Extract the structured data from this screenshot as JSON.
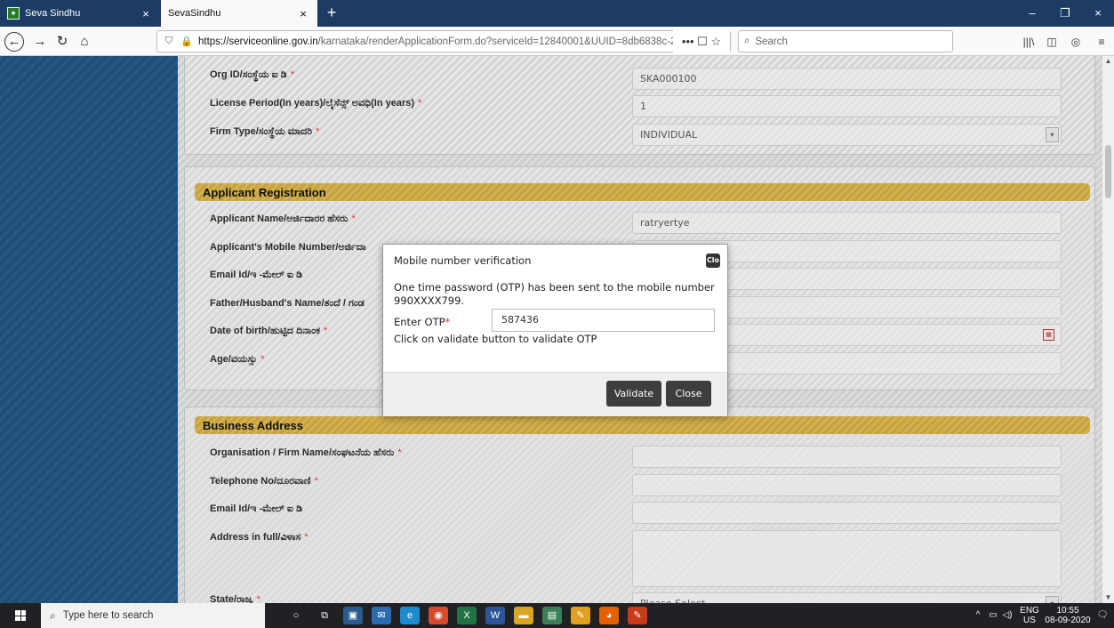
{
  "browser": {
    "tabs": [
      {
        "label": "Seva Sindhu",
        "close": "×"
      },
      {
        "label": "SevaSindhu",
        "close": "×"
      }
    ],
    "new_tab": "+",
    "window_controls": {
      "minimize": "–",
      "maximize": "❐",
      "close": "×"
    },
    "nav": {
      "back": "←",
      "forward": "→",
      "reload": "↻",
      "home": "⌂"
    },
    "url": {
      "host": "https://serviceonline.gov.in",
      "rest": "/karnataka/renderApplicationForm.do?serviceId=12840001&UUID=8db6838c-26(",
      "actions": "••• ☐ ☆"
    },
    "search_placeholder": "Search",
    "icons": [
      "library-icon",
      "sidebar-icon",
      "account-icon",
      "menu-icon"
    ]
  },
  "form": {
    "top_fields": [
      {
        "label": "Org ID/ಸಂಸ್ಥೆಯ ಐ ಡಿ",
        "required": "*",
        "value": "SKA000100",
        "kind": "text"
      },
      {
        "label": "License Period(In years)/ಲೈಸೆನ್ಸ್ ಅವಧಿ(In years)",
        "required": "*",
        "value": "1",
        "kind": "text"
      },
      {
        "label": "Firm Type/ಸಂಸ್ಥೆಯ ಮಾದರಿ",
        "required": "*",
        "value": "INDIVIDUAL",
        "kind": "select"
      }
    ],
    "applicant": {
      "heading": "Applicant Registration",
      "fields": [
        {
          "label": "Applicant Name/ಅರ್ಜಿದಾರರ ಹೆಸರು",
          "required": "*",
          "value": "ratryertye",
          "kind": "text"
        },
        {
          "label": "Applicant's Mobile Number/ಅರ್ಜಿದಾ",
          "required": "",
          "value": "",
          "kind": "text"
        },
        {
          "label": "Email Id/ಇ -ಮೇಲ್ ಐ ಡಿ",
          "required": "",
          "value": "om",
          "kind": "text"
        },
        {
          "label": "Father/Husband's Name/ತಂದೆ / ಗಂಡ",
          "required": "",
          "value": "",
          "kind": "text"
        },
        {
          "label": "Date of birth/ಹುಟ್ಟಿದ ದಿನಾಂಕ",
          "required": "*",
          "value": "",
          "kind": "date"
        },
        {
          "label": "Age/ವಯಸ್ಸು",
          "required": "*",
          "value": "",
          "kind": "text"
        }
      ]
    },
    "business": {
      "heading": "Business Address",
      "fields": [
        {
          "label": "Organisation / Firm Name/ಸಂಘಟನೆಯ ಹೆಸರು",
          "required": "*",
          "value": "",
          "kind": "text"
        },
        {
          "label": "Telephone No/ದೂರವಾಣಿ",
          "required": "*",
          "value": "",
          "kind": "text"
        },
        {
          "label": "Email Id/ಇ -ಮೇಲ್ ಐ ಡಿ",
          "required": "",
          "value": "",
          "kind": "text"
        },
        {
          "label": "Address in full/ವಿಳಾಸ",
          "required": "*",
          "value": "",
          "kind": "textarea"
        },
        {
          "label": "State/ರಾಜ್ಯ",
          "required": "*",
          "value": "Please Select",
          "kind": "select"
        }
      ]
    }
  },
  "modal": {
    "title": "Mobile number verification",
    "close_icon_text": "Clo",
    "message": "One time password (OTP) has been sent to the mobile number 990XXXX799.",
    "otp_label": "Enter OTP",
    "otp_required": "*",
    "otp_value": "587436",
    "hint": "Click on validate button to validate OTP",
    "validate_label": "Validate",
    "close_label": "Close"
  },
  "taskbar": {
    "search_placeholder": "Type here to search",
    "apps": [
      {
        "name": "cortana-icon",
        "glyph": "○",
        "color": "#1f2125"
      },
      {
        "name": "task-view-icon",
        "glyph": "⧉",
        "color": "#1f2125"
      },
      {
        "name": "store-icon",
        "glyph": "▣",
        "color": "#2b5b8a"
      },
      {
        "name": "mail-icon",
        "glyph": "✉",
        "color": "#2b6cb0"
      },
      {
        "name": "edge-icon",
        "glyph": "e",
        "color": "#1f8ad0"
      },
      {
        "name": "chrome-icon",
        "glyph": "◉",
        "color": "#d64a2f"
      },
      {
        "name": "excel-icon",
        "glyph": "X",
        "color": "#217346"
      },
      {
        "name": "word-icon",
        "glyph": "W",
        "color": "#2b579a"
      },
      {
        "name": "file-explorer-icon",
        "glyph": "▬",
        "color": "#d9a522"
      },
      {
        "name": "network-app-icon",
        "glyph": "▤",
        "color": "#3a7f5a"
      },
      {
        "name": "paint-icon",
        "glyph": "✎",
        "color": "#e0a020"
      },
      {
        "name": "firefox-icon",
        "glyph": "◕",
        "color": "#e66000"
      },
      {
        "name": "app-icon",
        "glyph": "✎",
        "color": "#c83a1a"
      }
    ],
    "tray": {
      "chevron": "^",
      "lang1": "ENG",
      "lang2": "US",
      "time": "10:55",
      "date": "08-09-2020",
      "notify": "🗨"
    }
  }
}
